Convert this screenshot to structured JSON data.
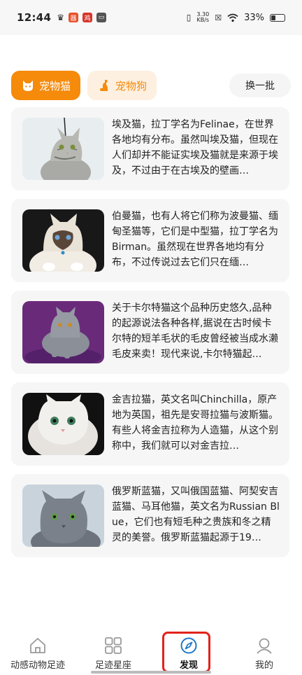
{
  "status_bar": {
    "time": "12:44",
    "net_speed_top": "3.30",
    "net_speed_bottom": "KB/s",
    "battery": "33%",
    "icons": [
      "crown-icon",
      "app-badge-icon",
      "app-badge-icon",
      "app-badge-icon",
      "vibrate-icon",
      "wifi-icon",
      "battery-icon"
    ]
  },
  "tabs": {
    "cat_label": "宠物猫",
    "dog_label": "宠物狗",
    "refresh_label": "换一批",
    "active": "cat",
    "accent": "#f58a0b"
  },
  "cards": [
    {
      "text": "埃及猫，拉丁学名为Felinae，在世界各地均有分布。虽然叫埃及猫，但现在人们却并不能证实埃及猫就是来源于埃及，不过由于在古埃及的壁画…",
      "image": "silver-tabby-cat-photo"
    },
    {
      "text": "伯曼猫，也有人将它们称为波曼猫、缅甸圣猫等，它们是中型猫，拉丁学名为Birman。虽然现在世界各地均有分布，不过传说过去它们只在缅…",
      "image": "birman-cat-photo"
    },
    {
      "text": "关于卡尔特猫这个品种历史悠久,品种的起源说法各种各样,据说在古时候卡尔特的短羊毛状的毛皮曾经被当成水濑毛皮来卖！现代来说,卡尔特猫起…",
      "image": "chartreux-cat-photo"
    },
    {
      "text": "金吉拉猫，英文名叫Chinchilla，原产地为英国，祖先是安哥拉猫与波斯猫。有些人将金吉拉称为人造猫，从这个别称中，我们就可以对金吉拉…",
      "image": "chinchilla-cat-photo"
    },
    {
      "text": "俄罗斯蓝猫，又叫俄国蓝猫、阿契安吉蓝猫、马耳他猫，英文名为Russian Blue，它们也有短毛种之贵族和冬之精灵的美誉。俄罗斯蓝猫起源于19…",
      "image": "russian-blue-cat-photo"
    }
  ],
  "bottom_nav": {
    "items": [
      {
        "label": "动感动物足迹",
        "icon": "home-icon"
      },
      {
        "label": "足迹星座",
        "icon": "grid-icon"
      },
      {
        "label": "发现",
        "icon": "compass-icon"
      },
      {
        "label": "我的",
        "icon": "user-icon"
      }
    ],
    "active_index": 2,
    "highlight_color": "#e2231a"
  }
}
